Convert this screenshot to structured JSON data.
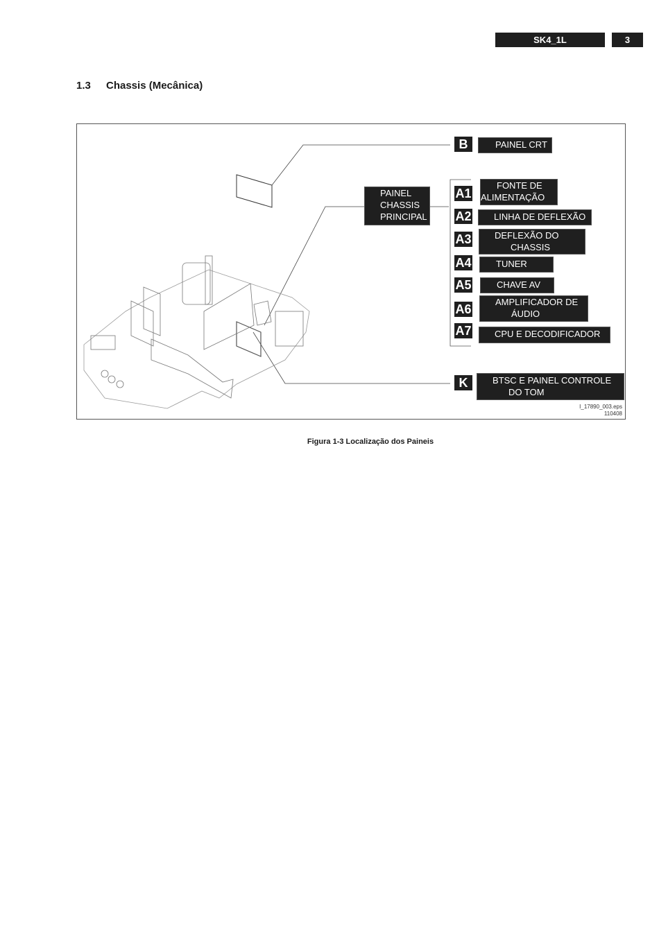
{
  "header": {
    "model": "SK4_1L",
    "page_number": "3"
  },
  "section": {
    "number": "1.3",
    "title": "Chassis  (Mecânica)"
  },
  "figure": {
    "main_board_label": [
      "PAINEL",
      "CHASSIS",
      "PRINCIPAL"
    ],
    "panels": [
      {
        "code": "B",
        "label_lines": [
          "PAINEL CRT"
        ]
      },
      {
        "code": "A1",
        "label_lines": [
          "FONTE DE",
          "ALIMENTAÇÃO"
        ]
      },
      {
        "code": "A2",
        "label_lines": [
          "LINHA DE DEFLEXÃO"
        ]
      },
      {
        "code": "A3",
        "label_lines": [
          "DEFLEXÃO DO",
          "CHASSIS"
        ]
      },
      {
        "code": "A4",
        "label_lines": [
          "TUNER"
        ]
      },
      {
        "code": "A5",
        "label_lines": [
          "CHAVE AV"
        ]
      },
      {
        "code": "A6",
        "label_lines": [
          "AMPLIFICADOR DE",
          "ÁUDIO"
        ]
      },
      {
        "code": "A7",
        "label_lines": [
          "CPU E DECODIFICADOR"
        ]
      },
      {
        "code": "K",
        "label_lines": [
          "BTSC E PAINEL CONTROLE",
          "DO TOM"
        ]
      }
    ],
    "file_ref": "I_17890_003.eps",
    "file_date": "110408"
  },
  "caption": "Figura 1-3 Localização dos Paineis"
}
